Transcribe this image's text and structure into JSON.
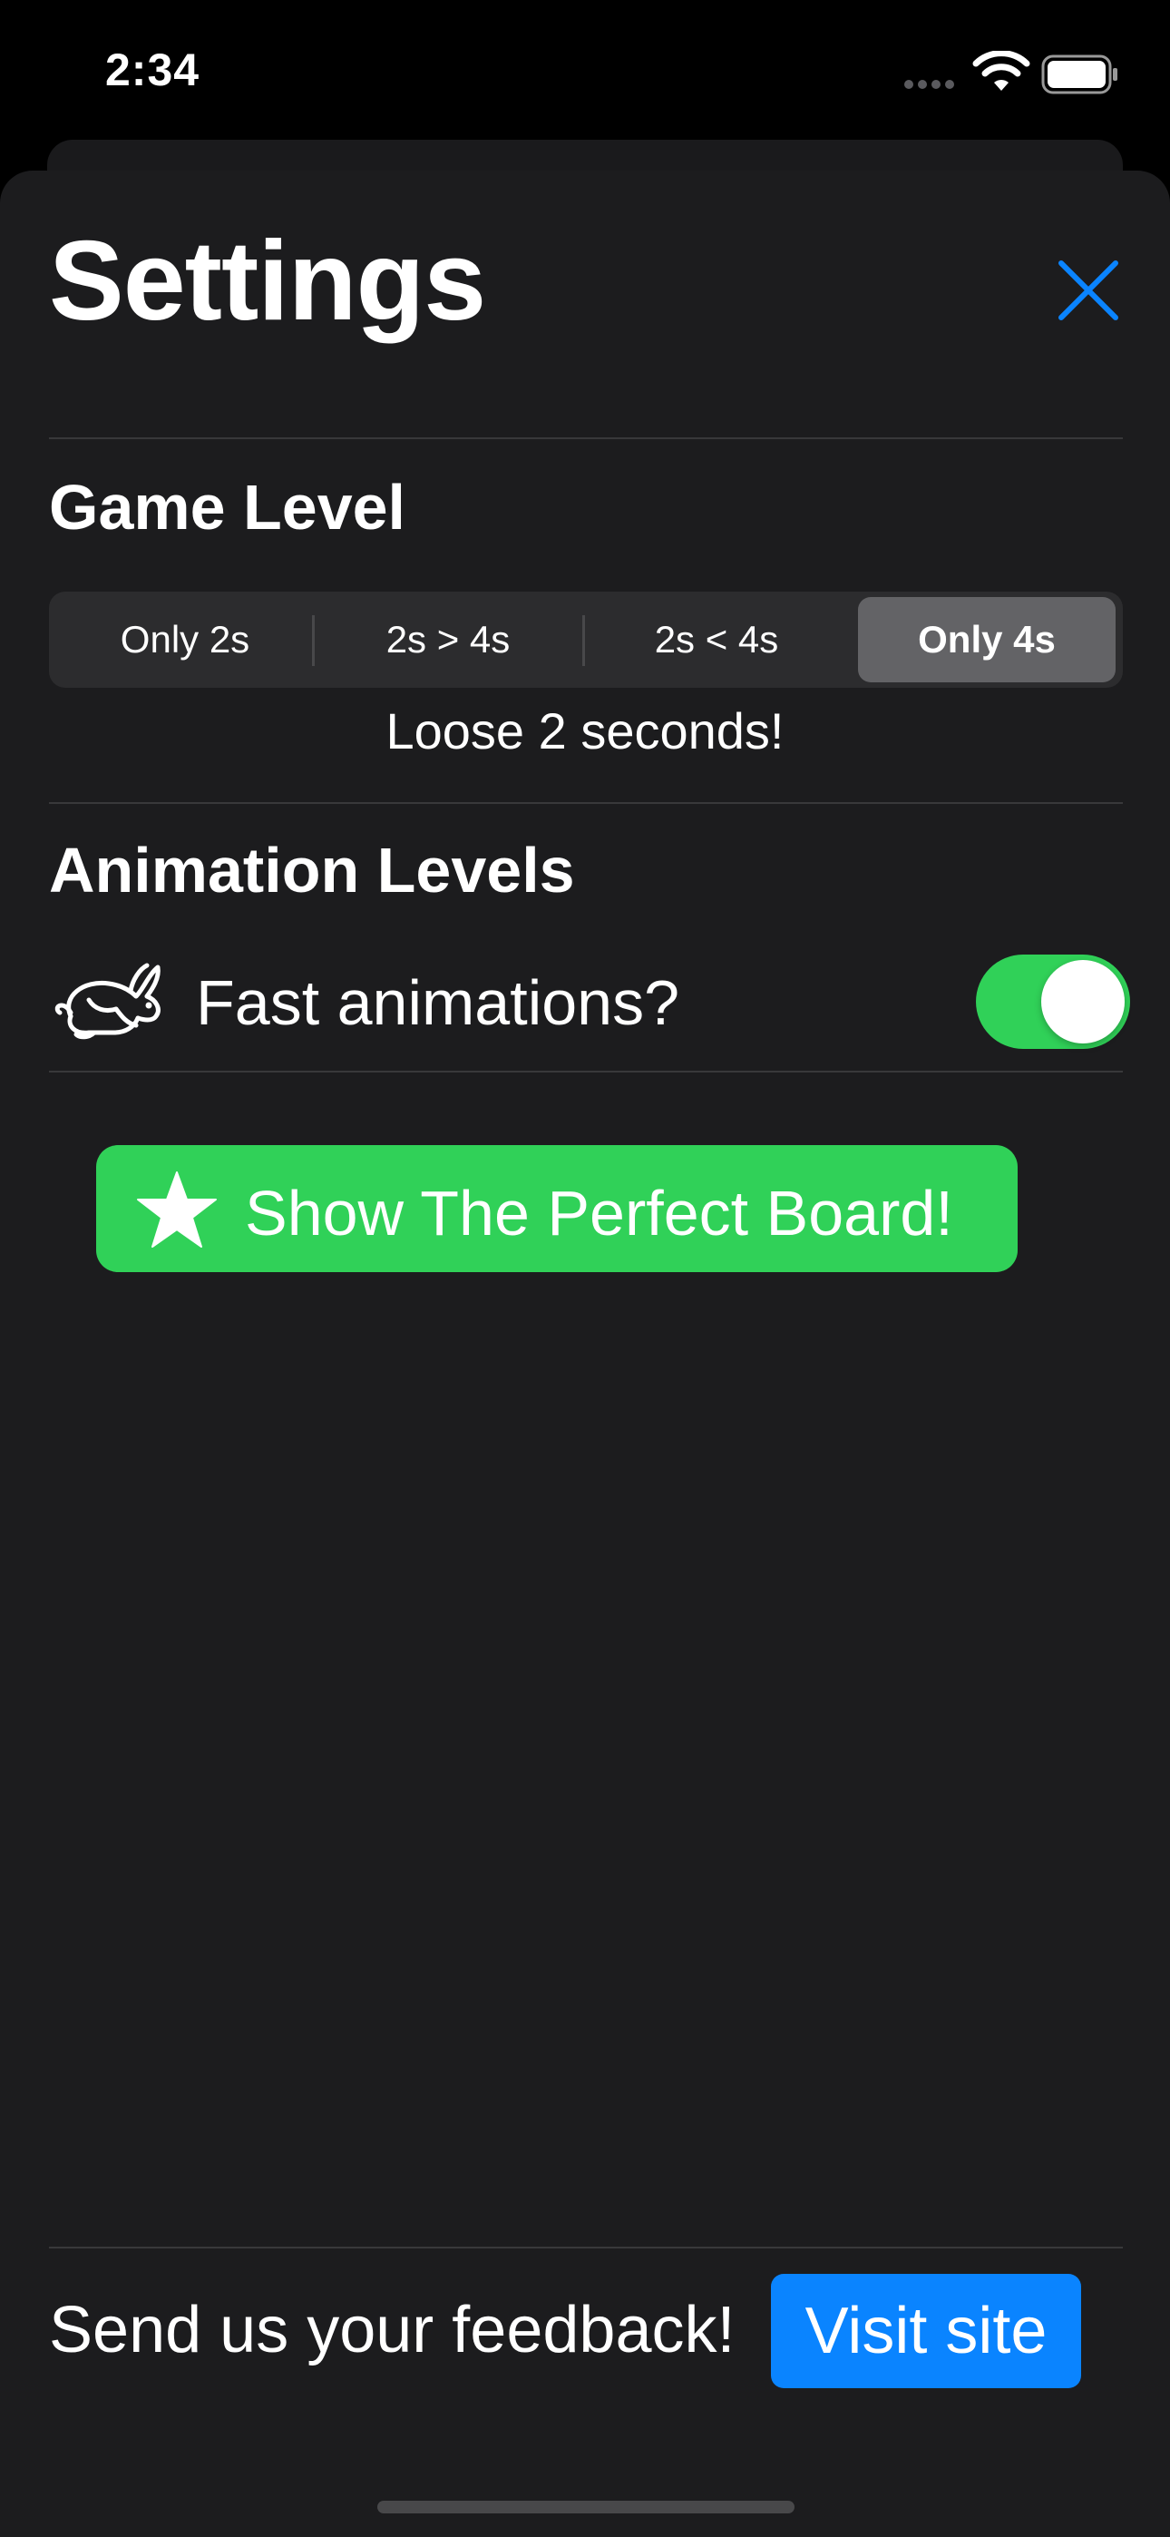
{
  "status_bar": {
    "time": "2:34"
  },
  "sheet": {
    "title": "Settings"
  },
  "game_level": {
    "title": "Game Level",
    "segments": [
      "Only 2s",
      "2s > 4s",
      "2s < 4s",
      "Only 4s"
    ],
    "selected": "Only 4s",
    "caption": "Loose 2 seconds!"
  },
  "animation": {
    "title": "Animation Levels",
    "fast_label": "Fast animations?",
    "fast_enabled": true
  },
  "perfect_board_button": {
    "label": "Show The Perfect Board!"
  },
  "footer": {
    "feedback_label": "Send us your feedback!",
    "visit_button": "Visit site"
  },
  "colors": {
    "accent_blue": "#0A84FF",
    "green": "#30D158",
    "background": "#1C1C1E"
  }
}
